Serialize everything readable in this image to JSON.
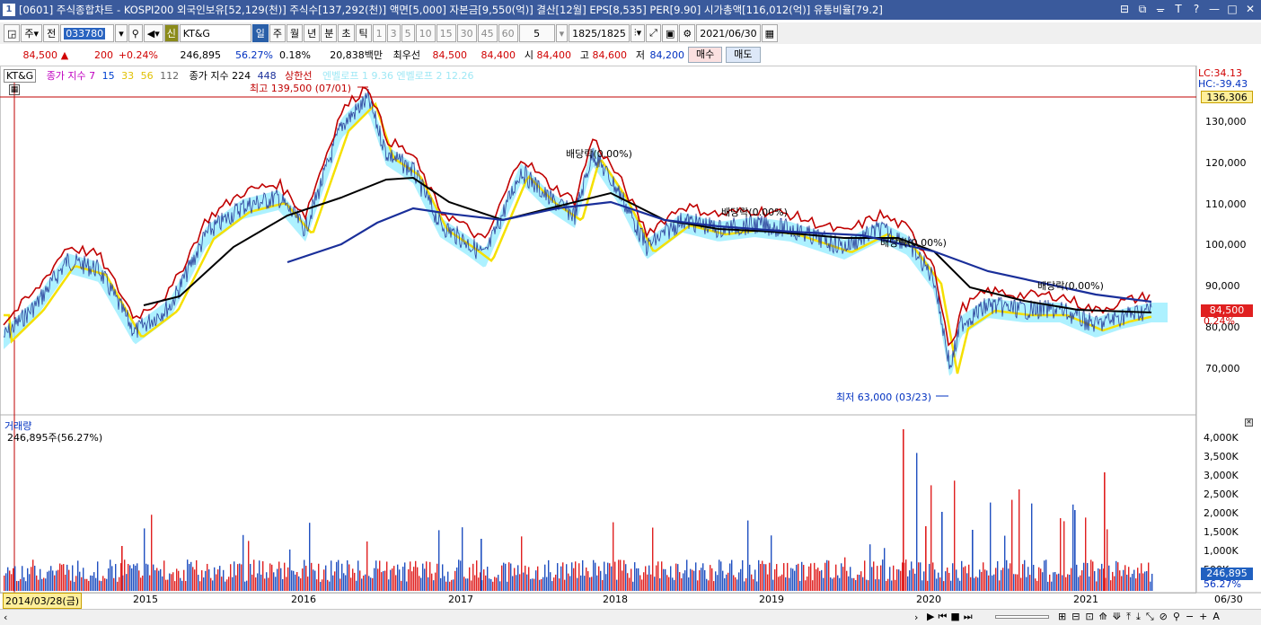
{
  "window": {
    "number": "1",
    "title": "[0601] 주식종합차트 - KOSPI200 외국인보유[52,129(천)] 주식수[137,292(천)] 액면[5,000] 자본금[9,550(억)] 결산[12월] EPS[8,535] PER[9.90] 시가총액[116,012(억)] 유통비율[79.2]"
  },
  "toolbar": {
    "period_sel": "주",
    "prev_label": "전",
    "stock_code": "033780",
    "stock_name": "KT&G",
    "sin_label": "신",
    "intervals": [
      "일",
      "주",
      "월",
      "년",
      "분",
      "초",
      "틱"
    ],
    "counts": [
      "1",
      "3",
      "5",
      "10",
      "15",
      "30",
      "45",
      "60"
    ],
    "count_value": "5",
    "bars": "1825/1825",
    "date": "2021/06/30"
  },
  "quote": {
    "price": "84,500",
    "arrow": "▲",
    "change": "200",
    "pct": "+0.24%",
    "volume": "246,895",
    "vol_ratio": "56.27%",
    "turnover": "0.18%",
    "amount": "20,838백만",
    "best_label": "최우선",
    "best_sell": "84,500",
    "best_buy": "84,400",
    "open_label": "시",
    "open": "84,400",
    "high_label": "고",
    "high": "84,600",
    "low_label": "저",
    "low": "84,200",
    "buy_label": "매수",
    "sell_label": "매도"
  },
  "legend": {
    "stock": "KT&G",
    "ma1_label": "종가 지수 7",
    "ma1_vals": [
      "15",
      "33",
      "56",
      "112"
    ],
    "ma2_label": "종가 지수 224",
    "ma2_vals": [
      "448"
    ],
    "upper": "상한선",
    "upper_faded": "엔벨로프 1 9.36  엔벨로프 2 12.26"
  },
  "annotations": {
    "high": "최고 139,500 (07/01)",
    "low": "최저 63,000 (03/23)",
    "div1": "배당락(0.00%)",
    "div2": "배당락(0.00%)",
    "div3": "배당락(0.00%)",
    "div4": "배당락(0.00%)"
  },
  "right_axis": {
    "lc": "LC:34.13",
    "hc": "HC:-39.43",
    "hi_box": "136,306",
    "ticks": [
      "130,000",
      "120,000",
      "110,000",
      "100,000",
      "90,000",
      "80,000",
      "70,000"
    ],
    "cur_price": "84,500",
    "cur_pct": "0.24%"
  },
  "volume_panel": {
    "title": "거래량",
    "value": "246,895주(56.27%)",
    "ticks": [
      "4,000K",
      "3,500K",
      "3,000K",
      "2,500K",
      "2,000K",
      "1,500K",
      "1,000K",
      "500K"
    ],
    "cur": "246,895",
    "cur_pct": "56.27%"
  },
  "xaxis": {
    "start": "2014/03/28(금)",
    "years": [
      "2015",
      "2016",
      "2017",
      "2018",
      "2019",
      "2020",
      "2021"
    ],
    "end": "06/30"
  },
  "colors": {
    "price": "#c00000",
    "ma_black": "#000000",
    "ma_blue": "#1a2f9a",
    "yellow": "#f5e000",
    "cyan": "#9fefff"
  }
}
